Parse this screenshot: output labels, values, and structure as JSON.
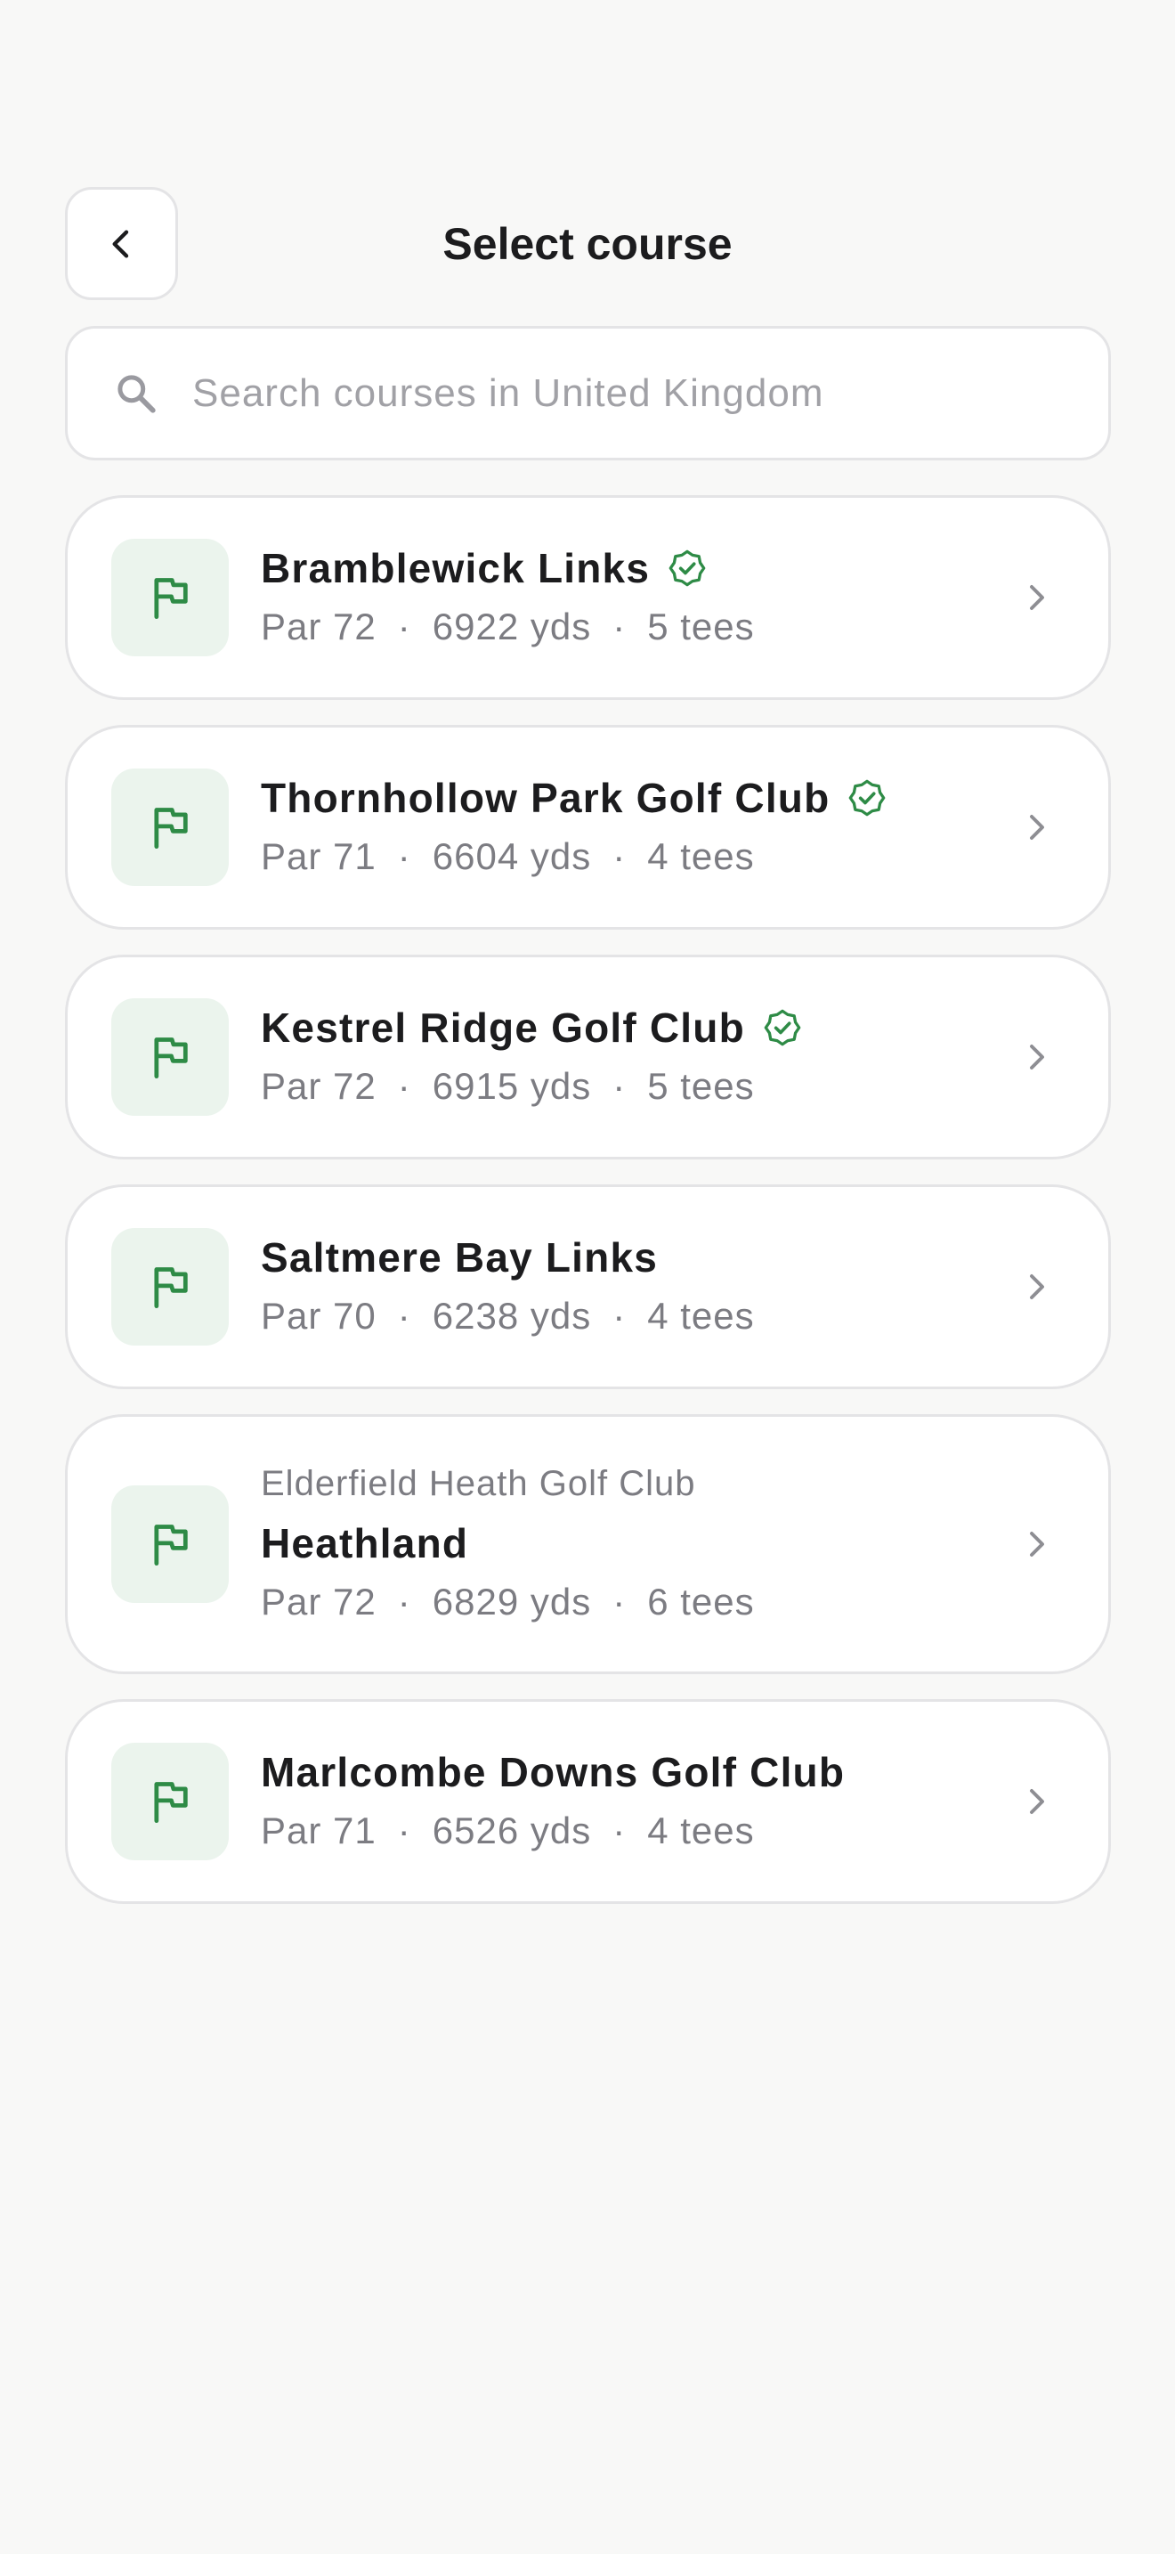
{
  "header": {
    "title": "Select course",
    "back_icon": "chevron-left-icon"
  },
  "search": {
    "placeholder": "Search courses in United Kingdom",
    "value": "",
    "icon": "search-icon"
  },
  "colors": {
    "background": "#f8f8f7",
    "card": "#ffffff",
    "border": "#e4e4e6",
    "accent_green": "#2e8b46",
    "flag_tile": "#ebf4ed",
    "muted_text": "#7c7c82",
    "placeholder_text": "#a1a1a6"
  },
  "courses": [
    {
      "name": "Bramblewick Links",
      "club": "",
      "verified": true,
      "par": "Par 72",
      "yards": "6922 yds",
      "tees": "5 tees"
    },
    {
      "name": "Thornhollow Park Golf Club",
      "club": "",
      "verified": true,
      "par": "Par 71",
      "yards": "6604 yds",
      "tees": "4 tees"
    },
    {
      "name": "Kestrel Ridge Golf Club",
      "club": "",
      "verified": true,
      "par": "Par 72",
      "yards": "6915 yds",
      "tees": "5 tees"
    },
    {
      "name": "Saltmere Bay Links",
      "club": "",
      "verified": false,
      "par": "Par 70",
      "yards": "6238 yds",
      "tees": "4 tees"
    },
    {
      "name": "Heathland",
      "club": "Elderfield Heath Golf Club",
      "verified": false,
      "par": "Par 72",
      "yards": "6829 yds",
      "tees": "6 tees"
    },
    {
      "name": "Marlcombe Downs Golf Club",
      "club": "",
      "verified": false,
      "par": "Par 71",
      "yards": "6526 yds",
      "tees": "4 tees"
    }
  ],
  "separator": "·"
}
